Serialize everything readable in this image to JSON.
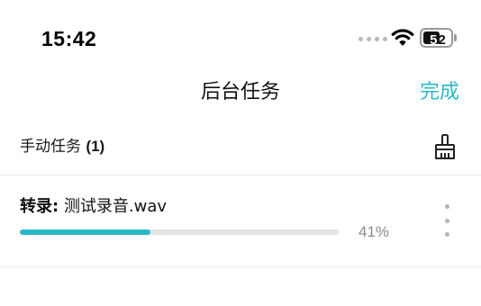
{
  "status_bar": {
    "time": "15:42",
    "battery_digit_1": "5",
    "battery_digit_2": "2",
    "battery_level_fraction": 0.52
  },
  "nav": {
    "title": "后台任务",
    "done_label": "完成",
    "accent_color": "#29b8c7"
  },
  "section": {
    "label": "手动任务",
    "count": "(1)",
    "action_icon": "broom-icon"
  },
  "tasks": [
    {
      "prefix": "转录:",
      "filename": "测试录音.wav",
      "progress_percent": 41,
      "progress_label": "41%",
      "menu_icon": "more-vertical-icon"
    }
  ]
}
